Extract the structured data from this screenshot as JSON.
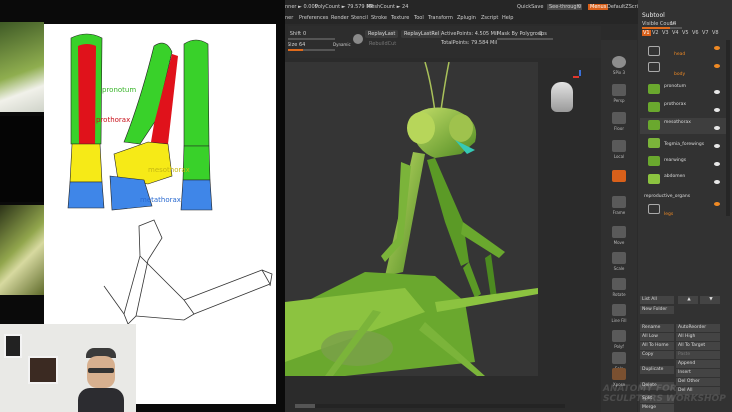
{
  "reference": {
    "labels": {
      "pronotum": "pronotum",
      "prothorax": "prothorax",
      "mesothorax": "mesothorax",
      "metathorax": "metathorax"
    },
    "colors": {
      "green": "#39d12a",
      "red": "#e0121b",
      "yellow": "#f6ea17",
      "blue": "#3f86e8"
    }
  },
  "menubar": {
    "items": [
      "ner",
      "Preferences",
      "Render",
      "Stencil",
      "Stroke",
      "Texture",
      "Tool",
      "Transform",
      "Zplugin",
      "Zscript",
      "Help"
    ],
    "stats": [
      "nner ► 0.009",
      "PolyCount ► 79.579 MP",
      "MeshCount ► 24"
    ],
    "quicksave": "QuickSave",
    "seethrough": "See-through",
    "seethrough_value": "0",
    "menus": "Menus",
    "default_zscript": "DefaultZScript"
  },
  "toolbar": {
    "shift_label": "d Shift",
    "shift_value": "0",
    "size_label": "Size",
    "size_value": "64",
    "dynamic": "Dynamic",
    "replay_last": "ReplayLast",
    "replay_last_rel": "ReplayLastRel",
    "rebuild_cut": "RebuildCut",
    "active_points": "ActivePoints: 4.505 Mil",
    "total_points": "TotalPoints: 79.584 Mil",
    "mask_by_polygroups": "Mask By Polygroups",
    "mask_value": "0"
  },
  "shelf": {
    "items": [
      "SPix 3",
      "Persp",
      "Floor",
      "Local",
      "Frame",
      "Move",
      "Scale",
      "Rotate",
      "Line Fill",
      "Polyf",
      "Solo",
      "Xpose"
    ]
  },
  "subtool": {
    "title": "Subtool",
    "visible_count_label": "Visible Count",
    "visible_count_value": "14",
    "tabs": [
      "V1",
      "V2",
      "V3",
      "V4",
      "V5",
      "V6",
      "V7",
      "V8"
    ],
    "items": [
      {
        "name": "head"
      },
      {
        "name": "body"
      },
      {
        "name": "pronotum"
      },
      {
        "name": "prothorax"
      },
      {
        "name": "mesothorax"
      },
      {
        "name": "Tegmia_forewings"
      },
      {
        "name": "rearwings"
      },
      {
        "name": "abdomen"
      },
      {
        "name": "reproductive_organs"
      },
      {
        "name": "legs"
      }
    ]
  },
  "subtool_buttons": {
    "list_all": "List All",
    "new_folder": "New Folder",
    "rename": "Rename",
    "auto_reorder": "AutoReorder",
    "all_low": "All Low",
    "all_high": "All High",
    "all_to_home": "All To Home",
    "all_to_target": "All To Target",
    "copy": "Copy",
    "paste": "Paste",
    "append": "Append",
    "duplicate": "Duplicate",
    "insert": "Insert",
    "del_other": "Del Other",
    "delete": "Delete",
    "del_all": "Del All",
    "split": "Split",
    "merge": "Merge"
  },
  "watermark": "ANATOMY FOR SCULPTORS WORKSHOP"
}
